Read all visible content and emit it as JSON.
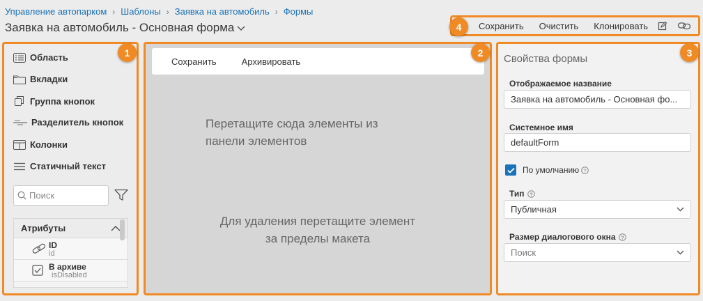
{
  "breadcrumb": {
    "items": [
      "Управление автопарком",
      "Шаблоны",
      "Заявка на автомобиль",
      "Формы"
    ]
  },
  "page_title": "Заявка на автомобиль - Основная форма",
  "toolbar": {
    "badge": "4",
    "save": "Сохранить",
    "clear": "Очистить",
    "clone": "Клонировать"
  },
  "left_panel": {
    "badge": "1",
    "elements": [
      "Область",
      "Вкладки",
      "Группа кнопок",
      "Разделитель кнопок",
      "Колонки",
      "Статичный текст"
    ],
    "search_placeholder": "Поиск",
    "attributes": {
      "header": "Атрибуты",
      "items": [
        {
          "name": "ID",
          "system": "id"
        },
        {
          "name": "В архиве",
          "system": "isDisabled"
        }
      ]
    }
  },
  "center_panel": {
    "badge": "2",
    "save": "Сохранить",
    "archive": "Архивировать",
    "drop_line1": "Перетащите сюда элементы из",
    "drop_line2": "панели элементов",
    "remove_line1": "Для удаления перетащите элемент",
    "remove_line2": "за пределы макета"
  },
  "right_panel": {
    "badge": "3",
    "title": "Свойства формы",
    "display_name_label": "Отображаемое название",
    "display_name_value": "Заявка на автомобиль - Основная фо...",
    "system_name_label": "Системное имя",
    "system_name_value": "defaultForm",
    "default_label": "По умолчанию",
    "default_checked": true,
    "type_label": "Тип",
    "type_value": "Публичная",
    "dialog_size_label": "Размер диалогового окна",
    "dialog_size_placeholder": "Поиск"
  },
  "colors": {
    "accent": "#f08a24",
    "link": "#1a73b8",
    "checkbox": "#1a73b8"
  }
}
